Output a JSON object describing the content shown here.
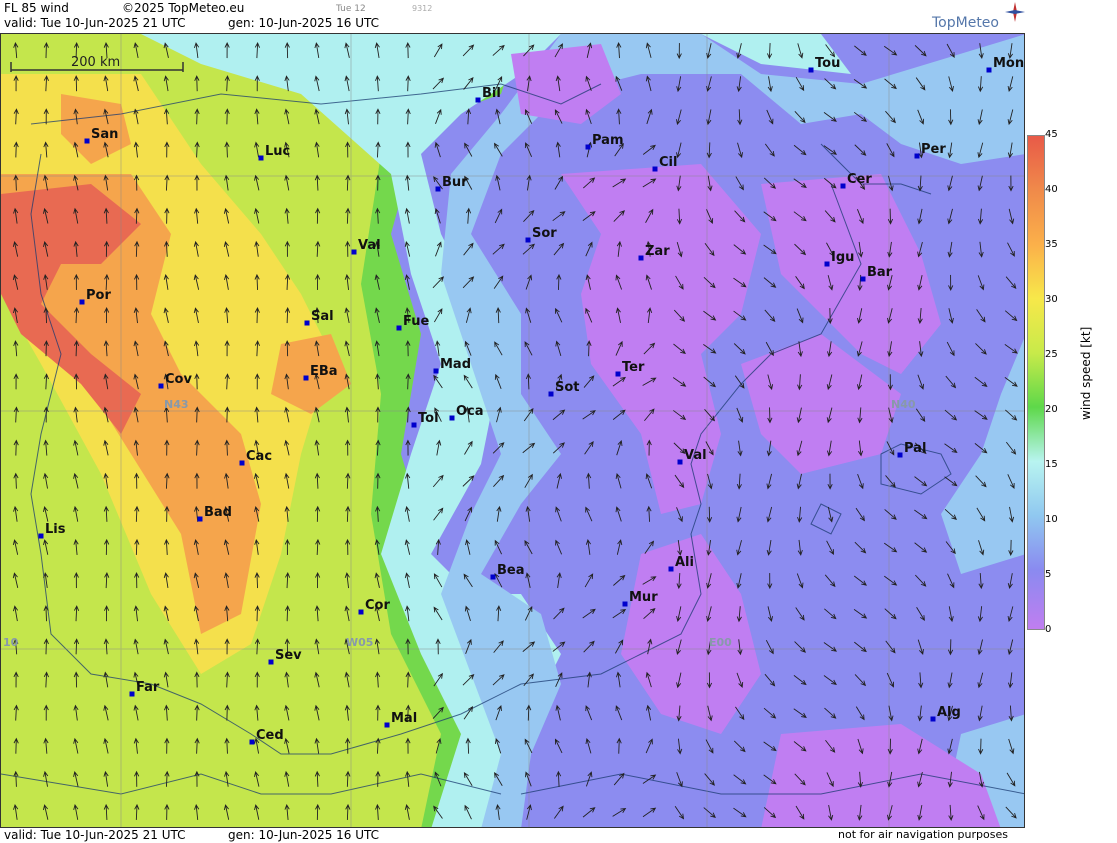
{
  "header": {
    "title": "FL 85 wind",
    "copyright": "©2025 TopMeteo.eu",
    "valid": "valid:  Tue  10-Jun-2025  21 UTC",
    "gen": "gen: 10-Jun-2025 16 UTC",
    "tue12": "Tue 12",
    "small_code": "9312",
    "brand": "TopMeteo"
  },
  "scale": {
    "label": "200 km"
  },
  "footer": {
    "valid": "valid:  Tue  10-Jun-2025  21 UTC",
    "gen": "gen: 10-Jun-2025 16 UTC",
    "note": "not for air navigation purposes"
  },
  "legend": {
    "ticks": [
      "45",
      "40",
      "35",
      "30",
      "25",
      "20",
      "15",
      "10",
      "5",
      "0"
    ],
    "axis_label": "wind speed  [kt]"
  },
  "grid_labels": [
    "N43",
    "N40",
    "W05",
    "E00",
    "10"
  ],
  "cities": [
    {
      "name": "Bil"
    },
    {
      "name": "Tou"
    },
    {
      "name": "Mon"
    },
    {
      "name": "San"
    },
    {
      "name": "Luc"
    },
    {
      "name": "Pam"
    },
    {
      "name": "Cil"
    },
    {
      "name": "Per"
    },
    {
      "name": "Bur"
    },
    {
      "name": "Cer"
    },
    {
      "name": "Sor"
    },
    {
      "name": "Val"
    },
    {
      "name": "Zar"
    },
    {
      "name": "Igu"
    },
    {
      "name": "Bar"
    },
    {
      "name": "Por"
    },
    {
      "name": "Sal"
    },
    {
      "name": "Fue"
    },
    {
      "name": "Mad"
    },
    {
      "name": "Ter"
    },
    {
      "name": "Cov"
    },
    {
      "name": "EBa"
    },
    {
      "name": "Sot"
    },
    {
      "name": "Tol"
    },
    {
      "name": "Oca"
    },
    {
      "name": "Pal"
    },
    {
      "name": "Cac"
    },
    {
      "name": "Val"
    },
    {
      "name": "Bad"
    },
    {
      "name": "Lis"
    },
    {
      "name": "Ali"
    },
    {
      "name": "Bea"
    },
    {
      "name": "Mur"
    },
    {
      "name": "Cor"
    },
    {
      "name": "Sev"
    },
    {
      "name": "Far"
    },
    {
      "name": "Mal"
    },
    {
      "name": "Alg"
    },
    {
      "name": "Ced"
    }
  ],
  "colors": {
    "red": "#e86a52",
    "orange": "#f5a54c",
    "yellow": "#f4e04c",
    "lime": "#c4e64c",
    "green": "#74d84c",
    "cyan": "#b0f0f0",
    "lightblue": "#98c8f2",
    "blue": "#8c8cf0",
    "violet": "#c07ef2",
    "city_dot": "#0000cc"
  }
}
